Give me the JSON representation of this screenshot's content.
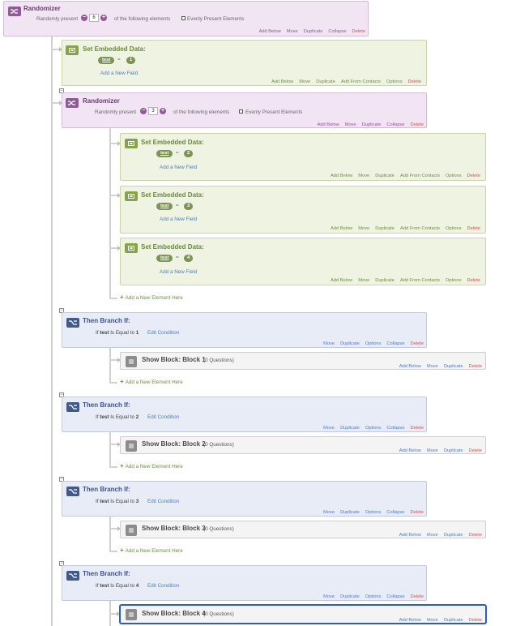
{
  "top_randomizer": {
    "title": "Randomizer",
    "randomly_present": "Randomly present",
    "count": "6",
    "of_following": "of the following elements",
    "evenly": "Evenly Present Elements",
    "actions": [
      "Add Below",
      "Move",
      "Duplicate",
      "Collapse",
      "Delete"
    ]
  },
  "embedded_1": {
    "title": "Set Embedded Data:",
    "field": "test",
    "equals": "=",
    "value": "1",
    "add_field": "Add a New Field",
    "actions": [
      "Add Below",
      "Move",
      "Duplicate",
      "Add From Contacts",
      "Options",
      "Delete"
    ]
  },
  "inner_randomizer": {
    "title": "Randomizer",
    "randomly_present": "Randomly present",
    "count": "3",
    "of_following": "of the following elements",
    "evenly": "Evenly Present Elements",
    "actions": [
      "Add Below",
      "Move",
      "Duplicate",
      "Collapse",
      "Delete"
    ]
  },
  "embedded_2": {
    "title": "Set Embedded Data:",
    "field": "test",
    "equals": "=",
    "value": "2",
    "add_field": "Add a New Field",
    "actions": [
      "Add Below",
      "Move",
      "Duplicate",
      "Add From Contacts",
      "Options",
      "Delete"
    ]
  },
  "embedded_3": {
    "title": "Set Embedded Data:",
    "field": "test",
    "equals": "=",
    "value": "3",
    "add_field": "Add a New Field",
    "actions": [
      "Add Below",
      "Move",
      "Duplicate",
      "Add From Contacts",
      "Options",
      "Delete"
    ]
  },
  "embedded_4": {
    "title": "Set Embedded Data:",
    "field": "test",
    "equals": "=",
    "value": "4",
    "add_field": "Add a New Field",
    "actions": [
      "Add Below",
      "Move",
      "Duplicate",
      "Add From Contacts",
      "Options",
      "Delete"
    ]
  },
  "add_new_element": "Add a New Element Here",
  "branches": [
    {
      "title": "Then Branch If:",
      "cond_prefix": "If",
      "cond_field": "test",
      "cond_op": "Is Equal to",
      "cond_value": "1",
      "edit": "Edit Condition",
      "actions": [
        "Move",
        "Duplicate",
        "Options",
        "Collapse",
        "Delete"
      ],
      "show_block": {
        "title": "Show Block: Block 1",
        "questions": "(0 Questions)",
        "actions": [
          "Add Below",
          "Move",
          "Duplicate",
          "Delete"
        ]
      }
    },
    {
      "title": "Then Branch If:",
      "cond_prefix": "If",
      "cond_field": "test",
      "cond_op": "Is Equal to",
      "cond_value": "2",
      "edit": "Edit Condition",
      "actions": [
        "Move",
        "Duplicate",
        "Options",
        "Collapse",
        "Delete"
      ],
      "show_block": {
        "title": "Show Block: Block 2",
        "questions": "(0 Questions)",
        "actions": [
          "Add Below",
          "Move",
          "Duplicate",
          "Delete"
        ]
      }
    },
    {
      "title": "Then Branch If:",
      "cond_prefix": "If",
      "cond_field": "test",
      "cond_op": "Is Equal to",
      "cond_value": "3",
      "edit": "Edit Condition",
      "actions": [
        "Move",
        "Duplicate",
        "Options",
        "Collapse",
        "Delete"
      ],
      "show_block": {
        "title": "Show Block: Block 3",
        "questions": "(0 Questions)",
        "actions": [
          "Add Below",
          "Move",
          "Duplicate",
          "Delete"
        ]
      }
    },
    {
      "title": "Then Branch If:",
      "cond_prefix": "If",
      "cond_field": "test",
      "cond_op": "Is Equal to",
      "cond_value": "4",
      "edit": "Edit Condition",
      "actions": [
        "Move",
        "Duplicate",
        "Options",
        "Collapse",
        "Delete"
      ],
      "show_block": {
        "title": "Show Block: Block 4",
        "questions": "(0 Questions)",
        "actions": [
          "Add Below",
          "Move",
          "Duplicate",
          "Delete"
        ]
      }
    }
  ]
}
